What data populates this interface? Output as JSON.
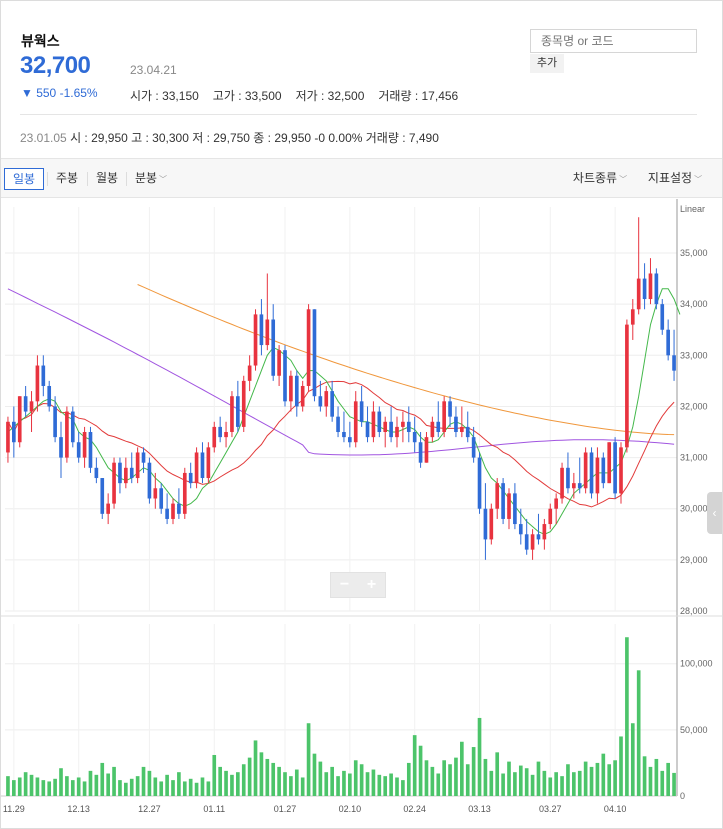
{
  "stock": {
    "name": "뷰웍스",
    "price": "32,700",
    "date": "23.04.21",
    "change": "▼ 550 -1.65%",
    "open": "시가 : 33,150",
    "high": "고가 : 33,500",
    "low": "저가 : 32,500",
    "volume": "거래량 : 17,456"
  },
  "search": {
    "placeholder": "종목명 or 코드",
    "add_label": "추가"
  },
  "history": {
    "date": "23.01.05",
    "values": "시 : 29,950  고 : 30,300  저 : 29,750  종 : 29,950 -0 0.00%  거래량 : 7,490"
  },
  "tabs": {
    "daily": "일봉",
    "weekly": "주봉",
    "monthly": "월봉",
    "minute": "분봉",
    "chart_type": "차트종류",
    "indicators": "지표설정"
  },
  "zoom": {
    "minus": "−",
    "plus": "+"
  },
  "colors": {
    "up": "#e8333f",
    "down": "#2f6bd6",
    "ma5": "#43b84a",
    "ma20": "#e23b3b",
    "ma60": "#a155e0",
    "ma120": "#f0973c",
    "volume": "#4cc46a"
  },
  "chart_data": {
    "type": "candlestick",
    "scale_label": "Linear",
    "price_ticks": [
      "35,000",
      "34,000",
      "33,000",
      "32,000",
      "31,000",
      "30,000",
      "29,000",
      "28,000"
    ],
    "price_tick_values": [
      35000,
      34000,
      33000,
      32000,
      31000,
      30000,
      29000,
      28000
    ],
    "ylim": [
      28000,
      35900
    ],
    "volume_ticks": [
      "100,000",
      "50,000",
      "0"
    ],
    "volume_tick_values": [
      100000,
      50000,
      0
    ],
    "x_labels": [
      "11.29",
      "12.13",
      "12.27",
      "01.11",
      "01.27",
      "02.10",
      "02.24",
      "03.13",
      "03.27",
      "04.10"
    ],
    "x_label_index": [
      1,
      12,
      24,
      35,
      47,
      58,
      69,
      80,
      92,
      103
    ],
    "candles": [
      [
        31100,
        31800,
        30900,
        31700,
        15000
      ],
      [
        31700,
        32000,
        31000,
        31300,
        12000
      ],
      [
        31300,
        32200,
        31200,
        32200,
        14000
      ],
      [
        32200,
        32400,
        31800,
        31900,
        18000
      ],
      [
        31900,
        32300,
        31500,
        32100,
        16000
      ],
      [
        32100,
        33000,
        31900,
        32800,
        14000
      ],
      [
        32800,
        33000,
        32200,
        32400,
        12000
      ],
      [
        32400,
        32500,
        31900,
        32000,
        11000
      ],
      [
        32000,
        32200,
        31300,
        31400,
        13000
      ],
      [
        31400,
        31700,
        30600,
        31000,
        21000
      ],
      [
        31000,
        32000,
        30900,
        31900,
        15000
      ],
      [
        31900,
        32000,
        31200,
        31300,
        12000
      ],
      [
        31300,
        31500,
        30900,
        31000,
        14000
      ],
      [
        31000,
        31600,
        30800,
        31500,
        11000
      ],
      [
        31500,
        31600,
        30700,
        30800,
        19000
      ],
      [
        30800,
        31000,
        30500,
        30600,
        16000
      ],
      [
        30600,
        30600,
        29800,
        29900,
        25000
      ],
      [
        29900,
        30300,
        29700,
        30100,
        17000
      ],
      [
        30100,
        31000,
        30000,
        30900,
        22000
      ],
      [
        30900,
        31000,
        30300,
        30500,
        12000
      ],
      [
        30500,
        31000,
        30400,
        30800,
        10000
      ],
      [
        30800,
        31100,
        30500,
        30600,
        13000
      ],
      [
        30600,
        31200,
        30500,
        31100,
        15000
      ],
      [
        31100,
        31200,
        30700,
        30900,
        22000
      ],
      [
        30900,
        31000,
        30100,
        30200,
        19000
      ],
      [
        30200,
        30700,
        30000,
        30400,
        14000
      ],
      [
        30400,
        30500,
        29900,
        30000,
        11000
      ],
      [
        30000,
        30300,
        29700,
        29800,
        16000
      ],
      [
        29800,
        30200,
        29700,
        30100,
        12000
      ],
      [
        30100,
        30400,
        29800,
        29900,
        18000
      ],
      [
        29900,
        30800,
        29800,
        30700,
        11000
      ],
      [
        30700,
        30900,
        30400,
        30500,
        13000
      ],
      [
        30500,
        31200,
        30400,
        31100,
        10000
      ],
      [
        31100,
        31300,
        30500,
        30600,
        14000
      ],
      [
        30600,
        31300,
        30500,
        31200,
        11000
      ],
      [
        31200,
        31700,
        31100,
        31600,
        31000
      ],
      [
        31600,
        31800,
        31300,
        31400,
        22000
      ],
      [
        31400,
        31700,
        31200,
        31500,
        19000
      ],
      [
        31500,
        32300,
        31400,
        32200,
        16000
      ],
      [
        32200,
        32500,
        31500,
        31600,
        18000
      ],
      [
        31600,
        32600,
        31500,
        32500,
        24000
      ],
      [
        32500,
        33000,
        32300,
        32800,
        29000
      ],
      [
        32800,
        33900,
        32700,
        33800,
        42000
      ],
      [
        33800,
        34100,
        33000,
        33200,
        33000
      ],
      [
        33200,
        34600,
        33100,
        33700,
        28000
      ],
      [
        33700,
        34000,
        32500,
        32600,
        25000
      ],
      [
        32600,
        33200,
        32400,
        33100,
        22000
      ],
      [
        33100,
        33200,
        32000,
        32100,
        18000
      ],
      [
        32100,
        32700,
        31900,
        32600,
        15000
      ],
      [
        32600,
        32700,
        31800,
        32000,
        20000
      ],
      [
        32000,
        32500,
        31900,
        32400,
        14000
      ],
      [
        32400,
        34000,
        32300,
        33900,
        55000
      ],
      [
        33900,
        33900,
        32100,
        32200,
        32000
      ],
      [
        32200,
        32500,
        31900,
        32000,
        26000
      ],
      [
        32000,
        32400,
        31800,
        32300,
        18000
      ],
      [
        32300,
        32500,
        31700,
        31800,
        22000
      ],
      [
        31800,
        32000,
        31400,
        31500,
        15000
      ],
      [
        31500,
        31900,
        31300,
        31400,
        19000
      ],
      [
        31400,
        31700,
        31200,
        31300,
        17000
      ],
      [
        31300,
        32300,
        31200,
        32100,
        27000
      ],
      [
        32100,
        32400,
        31600,
        31700,
        24000
      ],
      [
        31700,
        32000,
        31300,
        31400,
        18000
      ],
      [
        31400,
        32100,
        31300,
        31900,
        20000
      ],
      [
        31900,
        32000,
        31400,
        31500,
        16000
      ],
      [
        31500,
        31800,
        31200,
        31700,
        15000
      ],
      [
        31700,
        32000,
        31300,
        31400,
        17000
      ],
      [
        31400,
        31800,
        31200,
        31600,
        14000
      ],
      [
        31600,
        31900,
        31300,
        31700,
        12000
      ],
      [
        31700,
        32000,
        31300,
        31500,
        25000
      ],
      [
        31500,
        31800,
        31100,
        31300,
        46000
      ],
      [
        31300,
        31500,
        30800,
        30900,
        38000
      ],
      [
        30900,
        31500,
        30900,
        31400,
        27000
      ],
      [
        31400,
        31800,
        31300,
        31700,
        22000
      ],
      [
        31700,
        32100,
        31400,
        31500,
        17000
      ],
      [
        31500,
        32200,
        31400,
        32100,
        27000
      ],
      [
        32100,
        32200,
        31600,
        31800,
        24000
      ],
      [
        31800,
        32000,
        31400,
        31500,
        29000
      ],
      [
        31500,
        32000,
        31400,
        31600,
        41000
      ],
      [
        31600,
        31900,
        31300,
        31400,
        24000
      ],
      [
        31400,
        31600,
        30900,
        31000,
        37000
      ],
      [
        31000,
        31100,
        29900,
        30000,
        59000
      ],
      [
        30000,
        30500,
        29000,
        29400,
        28000
      ],
      [
        29400,
        30100,
        29300,
        30000,
        19000
      ],
      [
        30000,
        30600,
        29800,
        30500,
        33000
      ],
      [
        30500,
        30600,
        29700,
        29800,
        17000
      ],
      [
        29800,
        30400,
        29600,
        30300,
        26000
      ],
      [
        30300,
        30500,
        29600,
        29700,
        18000
      ],
      [
        29700,
        30000,
        29300,
        29500,
        23000
      ],
      [
        29500,
        29800,
        29100,
        29200,
        21000
      ],
      [
        29200,
        29600,
        29000,
        29500,
        16000
      ],
      [
        29500,
        29900,
        29300,
        29400,
        26000
      ],
      [
        29400,
        29800,
        29200,
        29700,
        19000
      ],
      [
        29700,
        30100,
        29600,
        30000,
        14000
      ],
      [
        30000,
        30300,
        29700,
        30200,
        18000
      ],
      [
        30200,
        30900,
        30100,
        30800,
        15000
      ],
      [
        30800,
        31100,
        30300,
        30400,
        24000
      ],
      [
        30400,
        30700,
        30200,
        30500,
        18000
      ],
      [
        30500,
        31000,
        30300,
        30400,
        19000
      ],
      [
        30400,
        31200,
        30300,
        31100,
        26000
      ],
      [
        31100,
        31200,
        30200,
        30300,
        22000
      ],
      [
        30300,
        31200,
        30100,
        31000,
        25000
      ],
      [
        31000,
        31100,
        30400,
        30500,
        32000
      ],
      [
        30500,
        31300,
        30500,
        31300,
        24000
      ],
      [
        31300,
        31400,
        30200,
        30300,
        27000
      ],
      [
        30300,
        31300,
        30100,
        31200,
        45000
      ],
      [
        31200,
        33700,
        31100,
        33600,
        120000
      ],
      [
        33600,
        34100,
        33300,
        33900,
        55000
      ],
      [
        33900,
        35700,
        33800,
        34500,
        95000
      ],
      [
        34500,
        34800,
        33900,
        34100,
        30000
      ],
      [
        34100,
        34900,
        34000,
        34600,
        22000
      ],
      [
        34600,
        34700,
        33900,
        34000,
        28000
      ],
      [
        34000,
        34100,
        33400,
        33500,
        19000
      ],
      [
        33500,
        33700,
        32900,
        33000,
        25000
      ],
      [
        33000,
        33500,
        32500,
        32700,
        17456
      ]
    ],
    "ma5": [
      31500,
      31600,
      31700,
      31800,
      31900,
      32000,
      32100,
      32150,
      32100,
      31900,
      31800,
      31750,
      31500,
      31400,
      31350,
      31200,
      31000,
      30800,
      30700,
      30600,
      30550,
      30600,
      30700,
      30800,
      30750,
      30600,
      30500,
      30350,
      30200,
      30100,
      30050,
      30100,
      30200,
      30400,
      30500,
      30700,
      30900,
      31100,
      31300,
      31500,
      31800,
      32100,
      32400,
      32700,
      33000,
      33150,
      33100,
      33000,
      32900,
      32700,
      32550,
      32700,
      32700,
      32600,
      32500,
      32300,
      32100,
      31950,
      31800,
      31750,
      31700,
      31700,
      31650,
      31600,
      31550,
      31500,
      31500,
      31550,
      31600,
      31550,
      31400,
      31300,
      31300,
      31350,
      31500,
      31650,
      31700,
      31650,
      31550,
      31400,
      31100,
      30800,
      30600,
      30500,
      30350,
      30200,
      30050,
      29900,
      29750,
      29650,
      29550,
      29500,
      29550,
      29700,
      29900,
      30100,
      30300,
      30400,
      30500,
      30600,
      30700,
      30700,
      30700,
      30800,
      30900,
      31200,
      31600,
      32200,
      32900,
      33600,
      34000,
      34300,
      34300,
      34100,
      33800
    ]
  }
}
